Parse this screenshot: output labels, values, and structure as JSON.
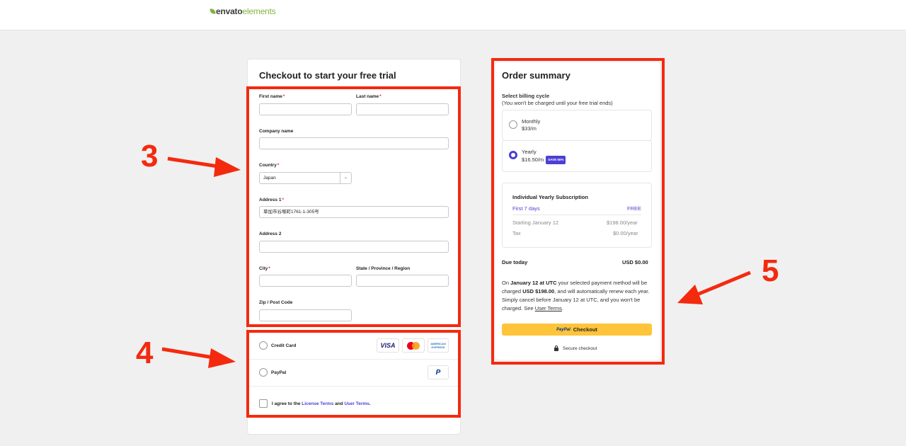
{
  "header": {
    "logo_part1": "envato",
    "logo_part2": "elements"
  },
  "form": {
    "title": "Checkout to start your free trial",
    "first_name_label": "First name",
    "last_name_label": "Last name",
    "company_label": "Company name",
    "country_label": "Country",
    "country_value": "Japan",
    "address1_label": "Address 1",
    "address1_value": "草加市谷塚町1761-1-305号",
    "address2_label": "Address 2",
    "city_label": "City",
    "state_label": "State / Province / Region",
    "zip_label": "Zip / Post Code",
    "required_mark": "*"
  },
  "payment": {
    "credit_card_label": "Credit Card",
    "paypal_label": "PayPal",
    "visa": "VISA",
    "amex_line1": "AMERICAN",
    "amex_line2": "EXPRESS",
    "paypal_logo": "P",
    "agree_prefix": "I agree to the ",
    "license_terms": "License Terms",
    "and": " and ",
    "user_terms": "User Terms",
    "period": "."
  },
  "summary": {
    "title": "Order summary",
    "billing_label": "Select billing cycle",
    "billing_note": "(You won't be charged until your free trial ends)",
    "monthly_name": "Monthly",
    "monthly_price": "$33/m",
    "yearly_name": "Yearly",
    "yearly_price": "$16.50/m",
    "save_badge": "SAVE 50%",
    "selected_cycle": "Yearly",
    "sub_title": "Individual Yearly Subscription",
    "trial_label": "First 7 days",
    "trial_value": "FREE",
    "starting_label": "Starting January 12",
    "starting_value": "$198.00/year",
    "tax_label": "Tax",
    "tax_value": "$0.00/year",
    "due_label": "Due today",
    "due_value": "USD $0.00",
    "desc_1": "On ",
    "desc_2": "January 12 at UTC",
    "desc_3": " your selected payment method will be charged ",
    "desc_4": "USD $198.00",
    "desc_5": ", and will automatically renew each year. Simply cancel before January 12 at UTC, and you won't be charged. See ",
    "desc_6": "User Terms",
    "desc_7": ".",
    "checkout_pp": "PayPal",
    "checkout_label": "Checkout",
    "secure_label": "Secure checkout"
  },
  "annotations": {
    "callout_3": "3",
    "callout_4": "4",
    "callout_5": "5",
    "color": "#f42a0f"
  }
}
